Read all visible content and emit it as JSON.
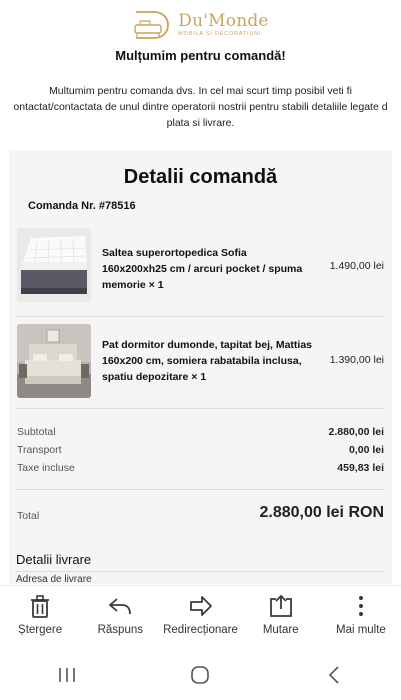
{
  "brand": {
    "name": "Du'Monde",
    "tagline": "MOBILA SI DECORATIUNI",
    "color": "#c9a55b"
  },
  "thanks": {
    "title": "Mulțumim pentru comandă!",
    "message": "Multumim pentru comanda dvs. In cel mai scurt timp posibil veti fi ontactat/contactata de unul dintre operatorii nostrii pentru stabili detaliile legate d plata si livrare."
  },
  "order": {
    "title": "Detalii comandă",
    "number": "Comanda Nr. #78516",
    "items": [
      {
        "name": "Saltea superortopedica Sofia 160x200xh25 cm / arcuri pocket / spuma memorie × 1",
        "price": "1.490,00 lei",
        "icon": "mattress-image"
      },
      {
        "name": "Pat dormitor dumonde, tapitat bej, Mattias 160x200 cm, somiera rabatabila inclusa, spatiu depozitare × 1",
        "price": "1.390,00 lei",
        "icon": "bed-image"
      }
    ],
    "summary": [
      {
        "label": "Subtotal",
        "value": "2.880,00 lei"
      },
      {
        "label": "Transport",
        "value": "0,00 lei"
      },
      {
        "label": "Taxe incluse",
        "value": "459,83 lei"
      }
    ],
    "total": {
      "label": "Total",
      "value": "2.880,00 lei RON"
    }
  },
  "delivery": {
    "title": "Detalii livrare",
    "address_label": "Adresa de livrare"
  },
  "actions": [
    {
      "label": "Ștergere",
      "icon": "trash-icon"
    },
    {
      "label": "Răspuns",
      "icon": "reply-icon"
    },
    {
      "label": "Redirecționare",
      "icon": "forward-icon"
    },
    {
      "label": "Mutare",
      "icon": "move-icon"
    },
    {
      "label": "Mai multe",
      "icon": "more-icon"
    }
  ],
  "navigation": [
    "recent-apps-icon",
    "home-icon",
    "back-icon"
  ]
}
